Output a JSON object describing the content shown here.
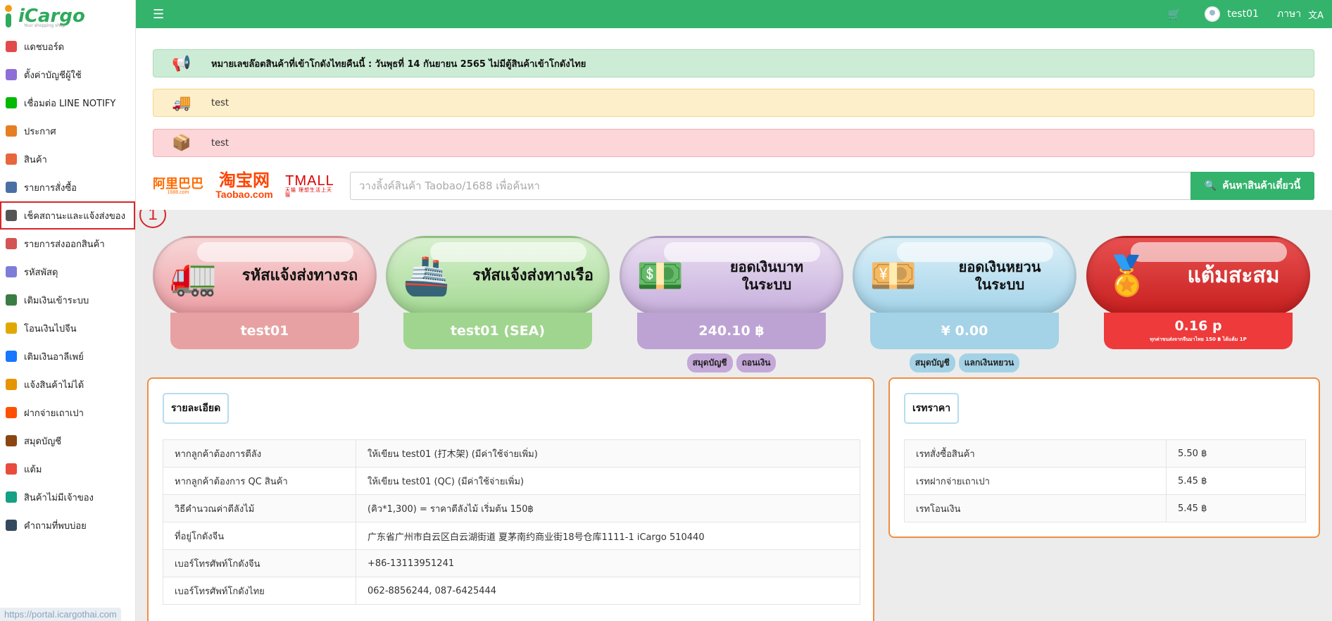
{
  "app": {
    "logo_text": "iCargo",
    "logo_tagline": "Your shopping shop"
  },
  "sidebar": {
    "items": [
      {
        "label": "แดชบอร์ด",
        "icon": "chart-icon",
        "color": "#e24b4b"
      },
      {
        "label": "ตั้งค่าบัญชีผู้ใช้",
        "icon": "user-settings-icon",
        "color": "#8e6fd6"
      },
      {
        "label": "เชื่อมต่อ LINE NOTIFY",
        "icon": "line-icon",
        "color": "#00b900"
      },
      {
        "label": "ประกาศ",
        "icon": "megaphone-icon",
        "color": "#e67e22"
      },
      {
        "label": "สินค้า",
        "icon": "product-icon",
        "color": "#e8663d"
      },
      {
        "label": "รายการสั่งซื้อ",
        "icon": "order-list-icon",
        "color": "#4a6fa5"
      },
      {
        "label": "เช็คสถานะและแจ้งส่งของ",
        "icon": "status-check-icon",
        "color": "#555555"
      },
      {
        "label": "รายการส่งออกสินค้า",
        "icon": "truck-icon",
        "color": "#d35454"
      },
      {
        "label": "รหัสพัสดุ",
        "icon": "parcel-code-icon",
        "color": "#7d7dd8"
      },
      {
        "label": "เติมเงินเข้าระบบ",
        "icon": "topup-icon",
        "color": "#3a7d44"
      },
      {
        "label": "โอนเงินไปจีน",
        "icon": "yuan-transfer-icon",
        "color": "#e0a800"
      },
      {
        "label": "เติมเงินอาลีเพย์",
        "icon": "alipay-icon",
        "color": "#1677ff"
      },
      {
        "label": "แจ้งสินค้าไม่ได้",
        "icon": "report-missing-icon",
        "color": "#e69500"
      },
      {
        "label": "ฝากจ่ายเถาเปา",
        "icon": "taobao-pay-icon",
        "color": "#ff5000"
      },
      {
        "label": "สมุดบัญชี",
        "icon": "ledger-icon",
        "color": "#8b4513"
      },
      {
        "label": "แต้ม",
        "icon": "points-icon",
        "color": "#e74c3c"
      },
      {
        "label": "สินค้าไม่มีเจ้าของ",
        "icon": "unclaimed-icon",
        "color": "#16a085"
      },
      {
        "label": "คำถามที่พบบ่อย",
        "icon": "faq-icon",
        "color": "#34495e"
      }
    ]
  },
  "step_marker": "1",
  "status_url": "https://portal.icargothai.com",
  "topbar": {
    "cart_icon": "cart-icon",
    "username": "test01",
    "language_label": "ภาษา",
    "translate_icon": "translate-icon"
  },
  "alerts": {
    "announcement": "หมายเลขล๊อตสินค้าที่เข้าโกดังไทยคืนนี้ : วันพุธที่ 14 กันยายน 2565 ไม่มีตู้สินค้าเข้าโกดังไทย",
    "truck_notice": "test",
    "box_notice": "test"
  },
  "marketplaces": {
    "alibaba": "阿里巴巴",
    "alibaba_sub": "1688.com",
    "taobao": "淘宝网",
    "taobao_sub": "Taobao.com",
    "tmall": "TMALL",
    "tmall_sub": "天猫 理想生活上天猫"
  },
  "search": {
    "placeholder": "วางลิ้งค์สินค้า Taobao/1688 เพื่อค้นหา",
    "button_label": "ค้นหาสินค้าเดี๋ยวนี้"
  },
  "cards": [
    {
      "title": "รหัสแจ้งส่งทางรถ",
      "value": "test01",
      "icon": "truck-icon"
    },
    {
      "title": "รหัสแจ้งส่งทางเรือ",
      "value": "test01 (SEA)",
      "icon": "ship-icon"
    },
    {
      "title_line1": "ยอดเงินบาท",
      "title_line2": "ในระบบ",
      "value": "240.10 ฿",
      "icon": "baht-coin-icon",
      "tags": [
        "สมุดบัญชี",
        "ถอนเงิน"
      ]
    },
    {
      "title_line1": "ยอดเงินหยวน",
      "title_line2": "ในระบบ",
      "value": "¥ 0.00",
      "icon": "yuan-money-icon",
      "tags": [
        "สมุดบัญชี",
        "แลกเงินหยวน"
      ]
    },
    {
      "title": "แต้มสะสม",
      "value": "0.16 p",
      "note": "ทุกค่าขนส่งจากจีนมาไทย 150 ฿ ได้แต้ม 1P",
      "icon": "star-medal-icon"
    }
  ],
  "details": {
    "heading": "รายละเอียด",
    "rows": [
      {
        "label": "หากลูกค้าต้องการตีลัง",
        "value": "ให้เขียน test01 (打木架) (มีค่าใช้จ่ายเพิ่ม)"
      },
      {
        "label": "หากลูกค้าต้องการ QC สินค้า",
        "value": "ให้เขียน test01 (QC) (มีค่าใช้จ่ายเพิ่ม)"
      },
      {
        "label": "วิธีคำนวณค่าตีลังไม้",
        "value": "(คิว*1,300) = ราคาตีลังไม้ เริ่มต้น 150฿"
      },
      {
        "label": "ที่อยู่โกดังจีน",
        "value": "广东省广州市白云区白云湖街道 夏茅南约商业街18号仓库1111-1 iCargo 510440"
      },
      {
        "label": "เบอร์โทรศัพท์โกดังจีน",
        "value": "+86-13113951241"
      },
      {
        "label": "เบอร์โทรศัพท์โกดังไทย",
        "value": "062-8856244, 087-6425444"
      }
    ]
  },
  "rates": {
    "heading": "เรทราคา",
    "rows": [
      {
        "label": "เรทสั่งซื้อสินค้า",
        "value": "5.50 ฿"
      },
      {
        "label": "เรทฝากจ่ายเถาเปา",
        "value": "5.45 ฿"
      },
      {
        "label": "เรทโอนเงิน",
        "value": "5.45 ฿"
      }
    ]
  }
}
